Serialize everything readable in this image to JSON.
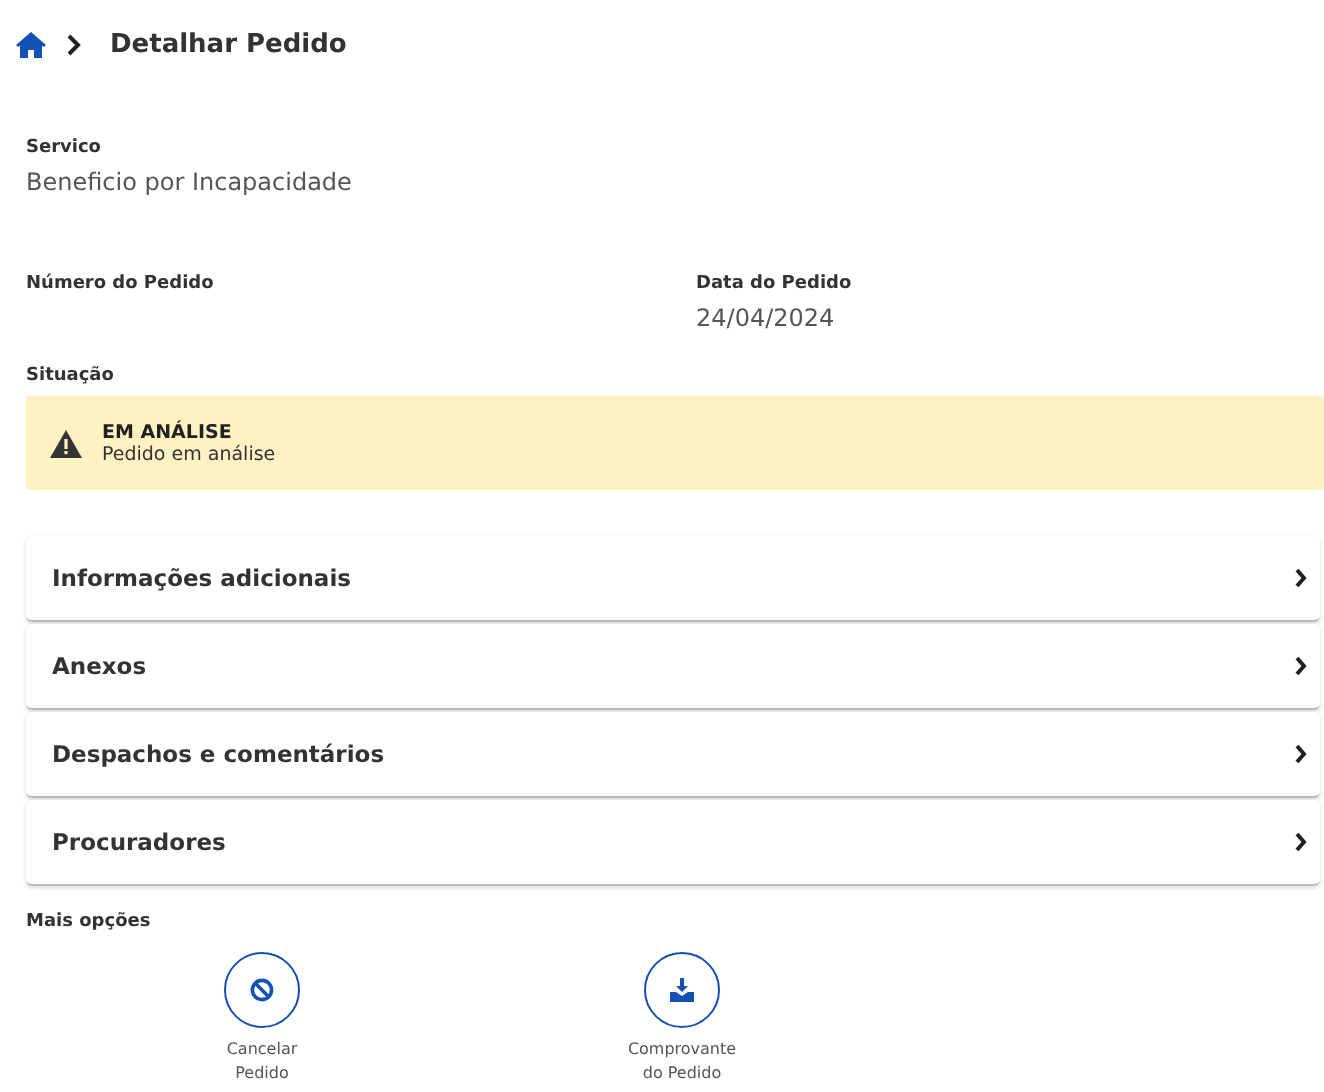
{
  "breadcrumb": {
    "title": "Detalhar Pedido"
  },
  "fields": [
    {
      "label": "Servico",
      "value": "Beneficio por Incapacidade"
    },
    {
      "label": "Número do Pedido"
    },
    {
      "label": "Data do Pedido",
      "value": "24/04/2024"
    }
  ],
  "status": {
    "label": "Situação",
    "title": "EM ANÁLISE",
    "text": "Pedido em análise"
  },
  "sections": [
    {
      "label": "Informações adicionais"
    },
    {
      "label": "Anexos"
    },
    {
      "label": "Despachos e comentários"
    },
    {
      "label": "Procuradores"
    }
  ],
  "more_options": {
    "label": "Mais opções",
    "actions": [
      {
        "kind": "cancel",
        "label": [
          "Cancelar",
          "Pedido"
        ]
      },
      {
        "kind": "download",
        "label": [
          "Comprovante",
          "do Pedido"
        ]
      }
    ]
  }
}
